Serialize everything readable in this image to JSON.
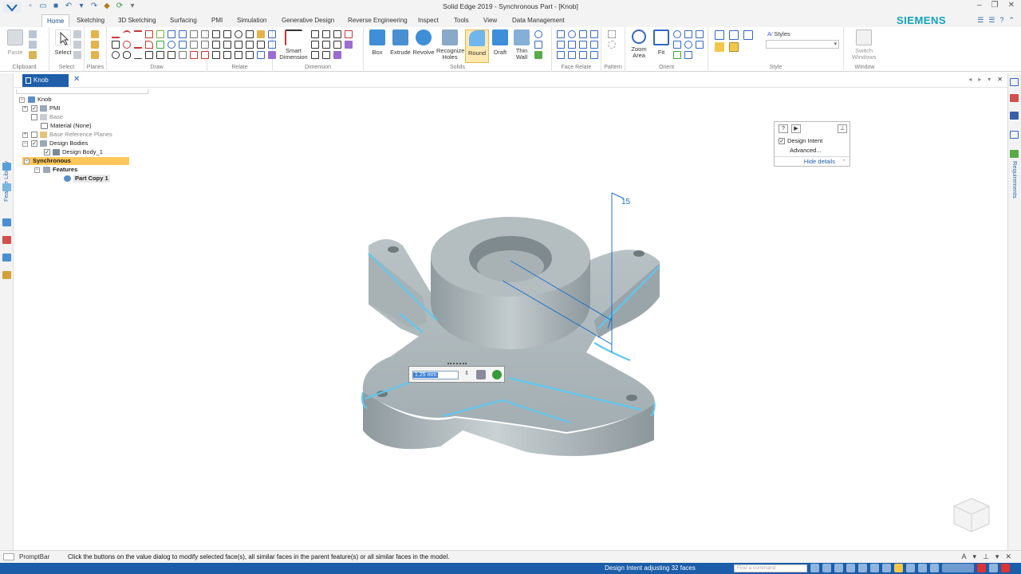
{
  "window": {
    "title": "Solid Edge 2019 - Synchronous Part - [Knob]",
    "brand": "SIEMENS"
  },
  "tabs": [
    {
      "label": "Home",
      "active": true
    },
    {
      "label": "Sketching"
    },
    {
      "label": "3D Sketching"
    },
    {
      "label": "Surfacing"
    },
    {
      "label": "PMI"
    },
    {
      "label": "Simulation"
    },
    {
      "label": "Generative Design"
    },
    {
      "label": "Reverse Engineering"
    },
    {
      "label": "Inspect"
    },
    {
      "label": "Tools"
    },
    {
      "label": "View"
    },
    {
      "label": "Data Management"
    }
  ],
  "ribbon": {
    "groups": {
      "clipboard": "Clipboard",
      "select": "Select",
      "planes": "Planes",
      "draw": "Draw",
      "relate": "Relate",
      "dimension": "Dimension",
      "solids": "Solids",
      "face_relate": "Face Relate",
      "pattern": "Pattern",
      "orient": "Orient",
      "style": "Style",
      "window": "Window"
    },
    "buttons": {
      "paste": "Paste",
      "select": "Select",
      "smart_dimension_1": "Smart",
      "smart_dimension_2": "Dimension",
      "box": "Box",
      "extrude": "Extrude",
      "revolve": "Revolve",
      "recognize_1": "Recognize",
      "recognize_2": "Holes",
      "round": "Round",
      "draft": "Draft",
      "thin_wall_1": "Thin",
      "thin_wall_2": "Wall",
      "zoom_area_1": "Zoom",
      "zoom_area_2": "Area",
      "fit": "Fit",
      "styles": "Styles",
      "switch_windows_1": "Switch",
      "switch_windows_2": "Windows"
    }
  },
  "document_tab": {
    "label": "Knob"
  },
  "side": {
    "feature_library": "Feature Library",
    "requirements": "Requirements"
  },
  "tree": {
    "root": "Knob",
    "pmi": "PMI",
    "base": "Base",
    "material": "Material (None)",
    "base_planes": "Base Reference Planes",
    "design_bodies": "Design Bodies",
    "design_body_1": "Design Body_1",
    "synchronous": "Synchronous",
    "features": "Features",
    "part_copy": "Part Copy 1"
  },
  "design_intent_panel": {
    "help": "?",
    "play": "▶",
    "pin": "⊥",
    "checkbox_label": "Design Intent",
    "checked": true,
    "advanced": "Advanced...",
    "hide_details": "Hide details"
  },
  "value_dialog": {
    "value": "1.25 mm",
    "accent_colors": {
      "similar": "#8a8a9a",
      "parent": "#3a9a3a"
    }
  },
  "viewport": {
    "annotation": "15"
  },
  "prompt_bar": {
    "label": "PromptBar",
    "message": "Click the buttons on the value dialog to modify selected face(s), all similar faces in the parent feature(s) or all similar faces in the model."
  },
  "status_bar": {
    "message": "Design Intent adjusting 32 faces",
    "find_placeholder": "Find a command"
  },
  "colors": {
    "accent": "#1b5da8",
    "brand": "#10a3ba",
    "highlight": "#ffc75a",
    "model_body": "#a7b2b6",
    "selected_edge": "#5ec8f0"
  }
}
